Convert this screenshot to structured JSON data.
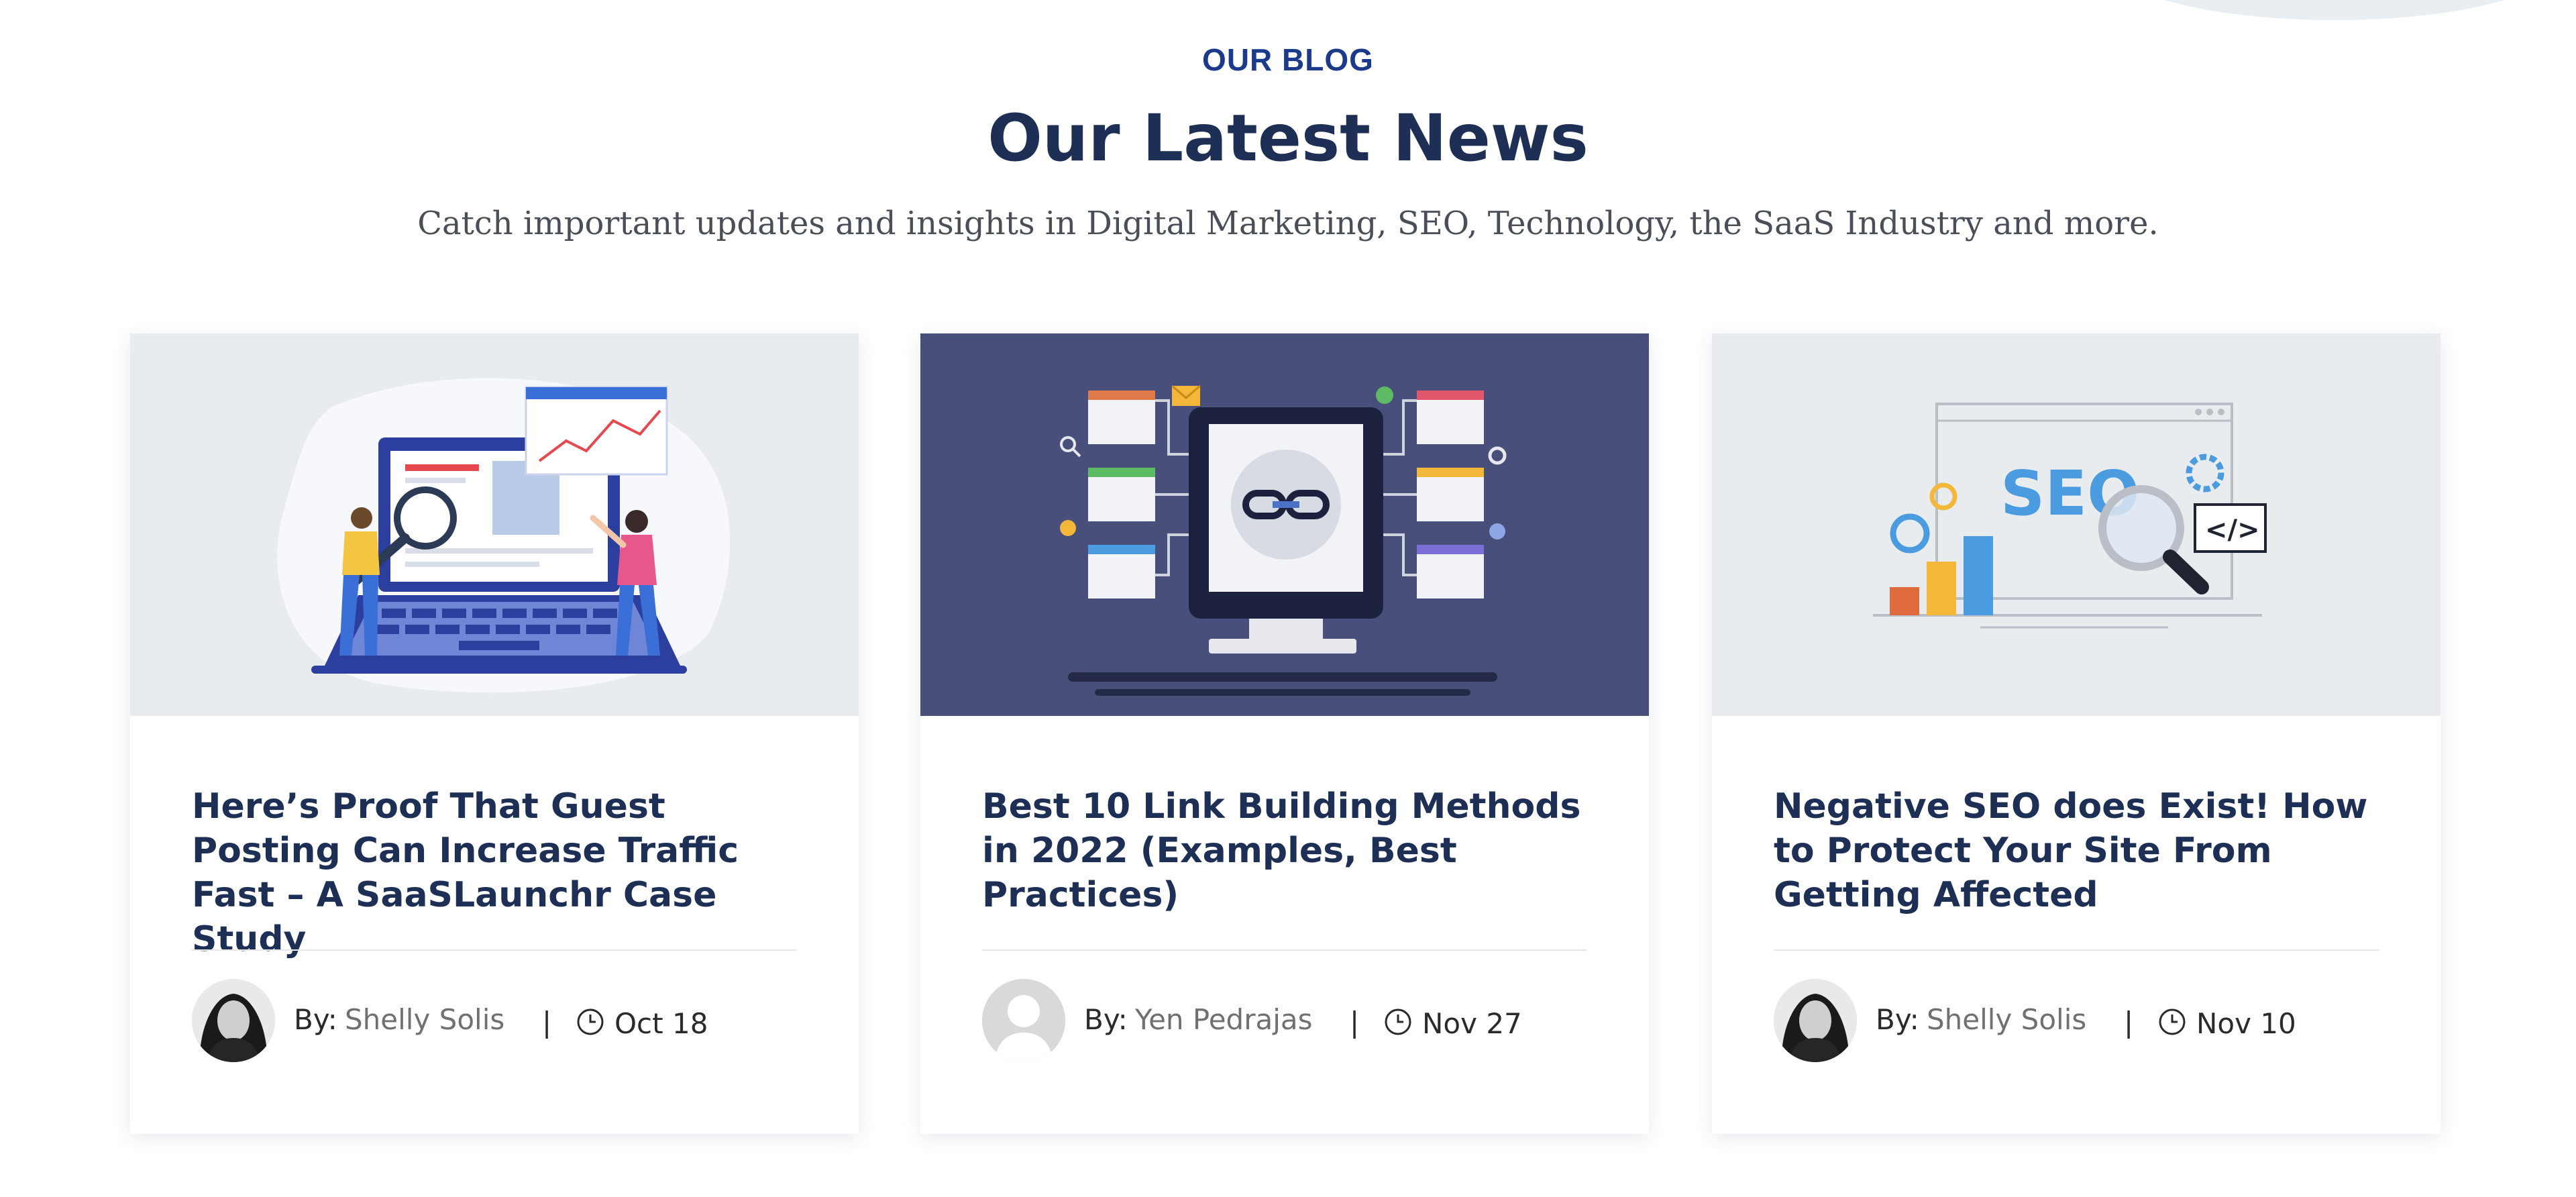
{
  "section": {
    "eyebrow": "OUR BLOG",
    "title": "Our Latest News",
    "subtitle": "Catch important updates and insights in Digital Marketing, SEO, Technology, the SaaS Industry and more."
  },
  "posts": [
    {
      "title": "Here’s Proof That Guest Posting Can Increase Traffic Fast – A SaaSLaunchr Case Study",
      "by_label": "By:",
      "author": "Shelly Solis",
      "separator": "|",
      "date": "Oct 18",
      "image": "guest-posting-illustration",
      "avatar": "photo-avatar"
    },
    {
      "title": "Best 10 Link Building Methods in 2022 (Examples, Best Practices)",
      "by_label": "By:",
      "author": "Yen Pedrajas",
      "separator": "|",
      "date": "Nov 27",
      "image": "link-building-illustration",
      "avatar": "default-avatar"
    },
    {
      "title": "Negative SEO does Exist! How to Protect Your Site From Getting Affected",
      "by_label": "By:",
      "author": "Shelly Solis",
      "separator": "|",
      "date": "Nov 10",
      "image": "seo-analysis-illustration",
      "avatar": "photo-avatar"
    }
  ],
  "illustration_text": {
    "seo": "SEO",
    "code": "</>"
  },
  "colors": {
    "heading": "#1e2f55",
    "eyebrow": "#1b3a8c",
    "card_2_background": "#474f7a",
    "image_background": "#e9ecef"
  }
}
